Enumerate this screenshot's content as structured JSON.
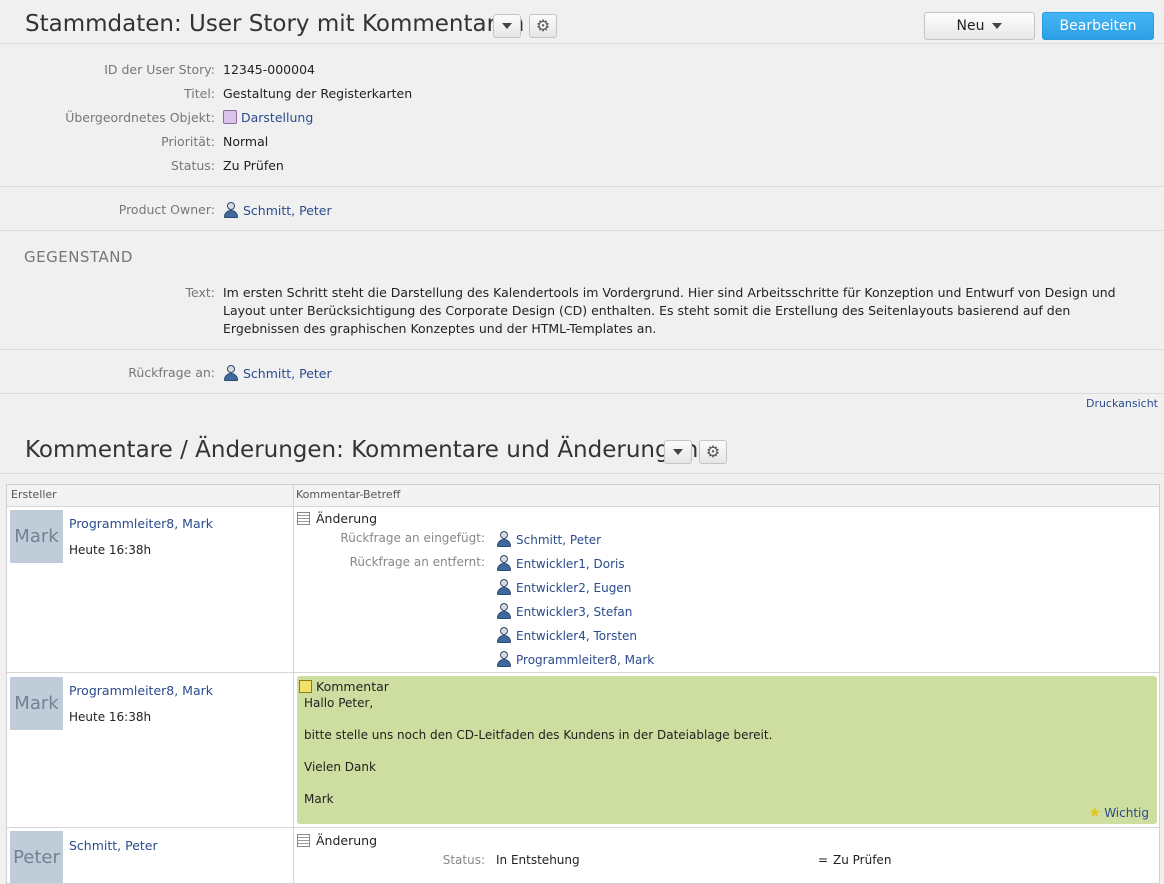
{
  "header": {
    "title": "Stammdaten: User Story mit Kommentaren",
    "new_button": "Neu",
    "edit_button": "Bearbeiten"
  },
  "fields": {
    "id_label": "ID der User Story:",
    "id_value": "12345-000004",
    "title_label": "Titel:",
    "title_value": "Gestaltung der Registerkarten",
    "parent_label": "Übergeordnetes Objekt:",
    "parent_value": "Darstellung",
    "priority_label": "Priorität:",
    "priority_value": "Normal",
    "status_label": "Status:",
    "status_value": "Zu Prüfen",
    "po_label": "Product Owner:",
    "po_value": "Schmitt, Peter"
  },
  "subject": {
    "section_title": "GEGENSTAND",
    "text_label": "Text:",
    "text_value": "Im ersten Schritt steht die Darstellung des Kalendertools im Vordergrund. Hier sind Arbeitsschritte für Konzeption und Entwurf von Design und Layout unter Berücksichtigung des Corporate Design (CD) enthalten. Es steht somit die Erstellung des Seitenlayouts basierend auf den Ergebnissen des graphischen Konzeptes und der HTML-Templates an.",
    "query_label": "Rückfrage an:",
    "query_value": "Schmitt, Peter"
  },
  "print_link": "Druckansicht",
  "comments_section": {
    "title": "Kommentare / Änderungen: Kommentare und Änderungen",
    "col_author": "Ersteller",
    "col_subject": "Kommentar-Betreff",
    "rows": [
      {
        "avatar": "Mark",
        "author": "Programmleiter8, Mark",
        "time": "Heute  16:38h",
        "type": "Änderung",
        "added_label": "Rückfrage an eingefügt:",
        "added": [
          "Schmitt, Peter"
        ],
        "removed_label": "Rückfrage an entfernt:",
        "removed": [
          "Entwickler1, Doris",
          "Entwickler2, Eugen",
          "Entwickler3, Stefan",
          "Entwickler4, Torsten",
          "Programmleiter8, Mark"
        ]
      },
      {
        "avatar": "Mark",
        "author": "Programmleiter8, Mark",
        "time": "Heute  16:38h",
        "type": "Kommentar",
        "lines": [
          "Hallo Peter,",
          "bitte stelle uns noch den CD-Leitfaden des Kundens in der Dateiablage bereit.",
          "Vielen Dank",
          "Mark"
        ],
        "flag": "Wichtig"
      },
      {
        "avatar": "Peter",
        "author": "Schmitt, Peter",
        "type": "Änderung",
        "status_label": "Status:",
        "status_old": "In Entstehung",
        "status_arrow": "=",
        "status_new": "Zu Prüfen"
      }
    ]
  }
}
